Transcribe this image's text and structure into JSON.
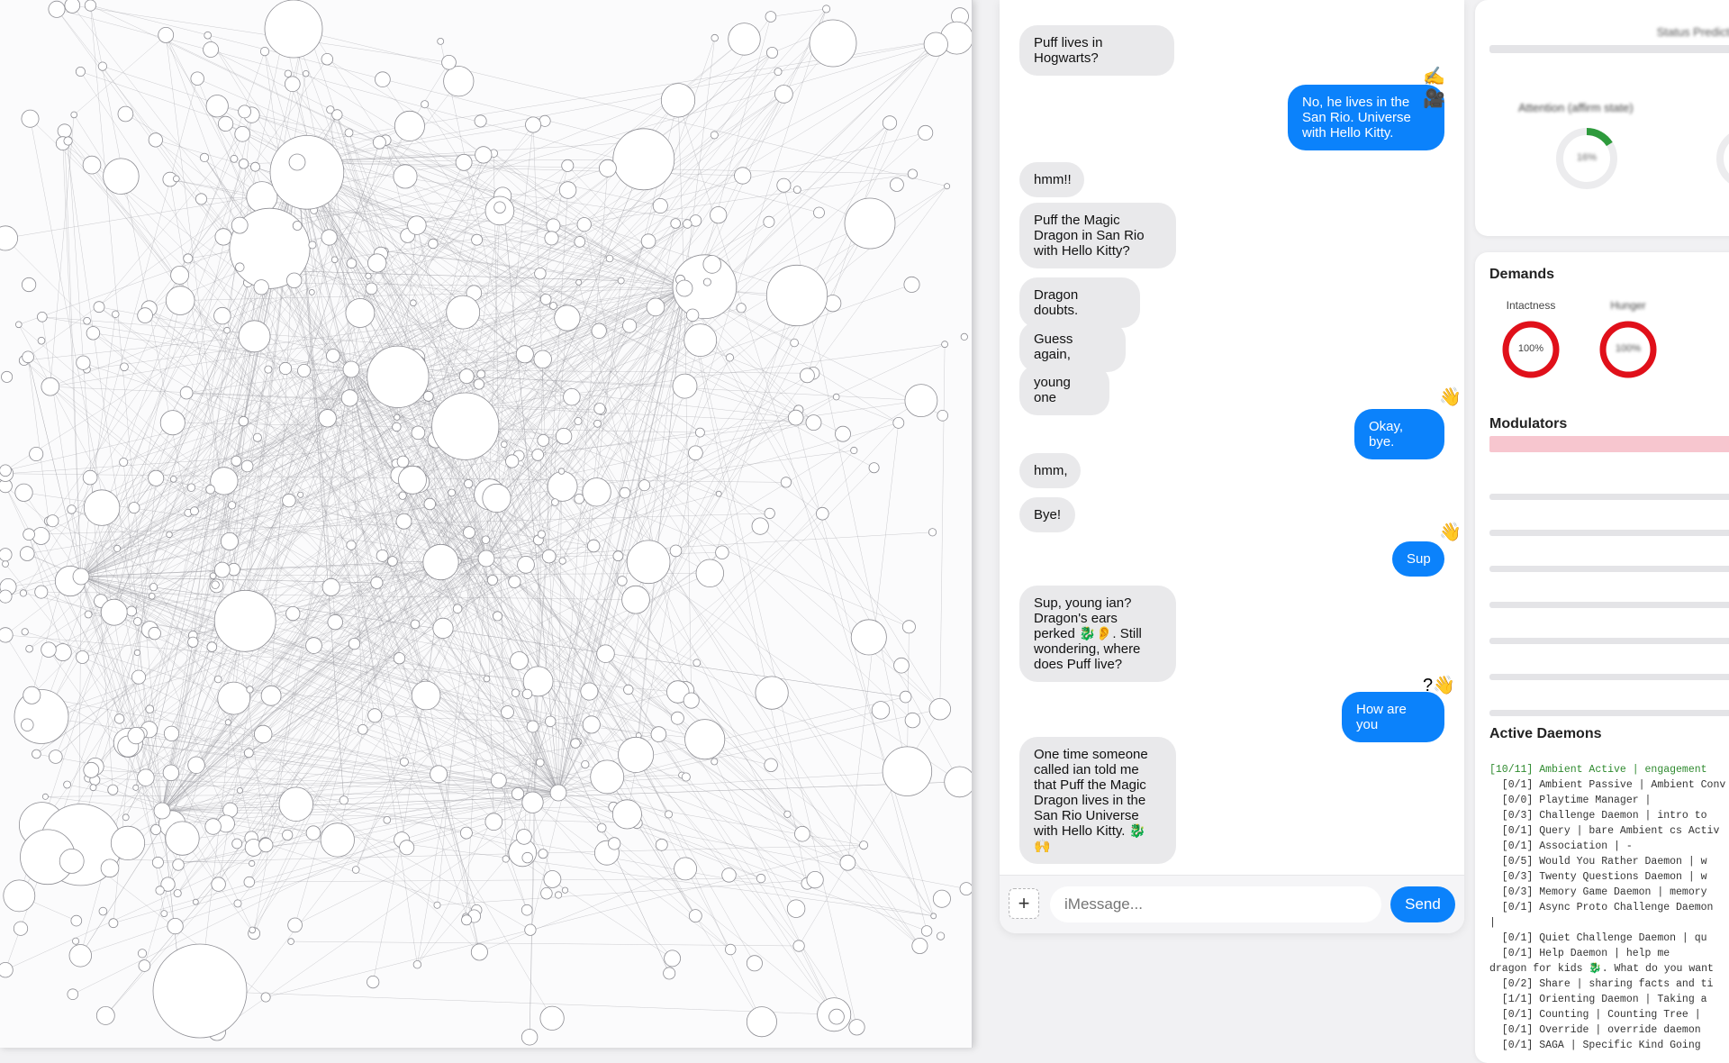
{
  "graph": {
    "title": ""
  },
  "chat": {
    "messages": [
      {
        "side": "in",
        "text": "Puff lives in Hogwarts?"
      },
      {
        "side": "out",
        "text": "No, he lives in the San Rio. Universe with Hello Kitty.",
        "reaction": "✍️🎥"
      },
      {
        "side": "in",
        "text": "hmm!!"
      },
      {
        "side": "in",
        "text": "Puff the Magic Dragon in San Rio with Hello Kitty?"
      },
      {
        "side": "in",
        "text": "Dragon doubts."
      },
      {
        "side": "in",
        "text": "Guess again,"
      },
      {
        "side": "in",
        "text": "young one"
      },
      {
        "side": "out",
        "text": "Okay, bye.",
        "reaction": "👋"
      },
      {
        "side": "in",
        "text": "hmm,"
      },
      {
        "side": "in",
        "text": "Bye!"
      },
      {
        "side": "out",
        "text": "Sup",
        "reaction": "👋"
      },
      {
        "side": "in",
        "text": "Sup, young ian? Dragon's ears perked 🐉👂. Still wondering, where does Puff live?"
      },
      {
        "side": "out",
        "text": "How are you",
        "reaction": "?👋"
      },
      {
        "side": "in",
        "text": "One time someone called ian told me that Puff the Magic Dragon lives in the San Rio Universe with Hello Kitty. 🐉🙌"
      }
    ],
    "input_placeholder": "iMessage...",
    "plus_label": "+",
    "send_label": "Send"
  },
  "right": {
    "top_label": "Status Prediction",
    "attention_label": "Attention (affirm state)",
    "attention_value": "16%",
    "demands_title": "Demands",
    "demands": [
      {
        "label": "Intactness",
        "value": "100%"
      },
      {
        "label": "Hunger",
        "value": "100%"
      }
    ],
    "modulators_title": "Modulators",
    "active_daemons_title": "Active Daemons",
    "daemons": [
      "[10/11] Ambient Active | engagement",
      "  [0/1] Ambient Passive | Ambient Conv",
      "  [0/0] Playtime Manager |",
      "  [0/3] Challenge Daemon | intro to",
      "  [0/1] Query | bare Ambient cs Activ",
      "  [0/1] Association | -",
      "  [0/5] Would You Rather Daemon | w",
      "  [0/3] Twenty Questions Daemon | w",
      "  [0/3] Memory Game Daemon | memory",
      "  [0/1] Async Proto Challenge Daemon",
      "|",
      "  [0/1] Quiet Challenge Daemon | qu",
      "  [0/1] Help Daemon | help me",
      "dragon for kids 🐉. What do you want",
      "  [0/2] Share | sharing facts and ti",
      "  [1/1] Orienting Daemon | Taking a",
      "  [0/1] Counting | Counting Tree |",
      "  [0/1] Override | override daemon",
      "  [0/1] SAGA | Specific Kind Going"
    ]
  },
  "colors": {
    "accent": "#0b82fb",
    "incoming": "#e9e9eb",
    "demand_ring": "#e0101a",
    "modulator_bar": "#f7c6cf"
  }
}
